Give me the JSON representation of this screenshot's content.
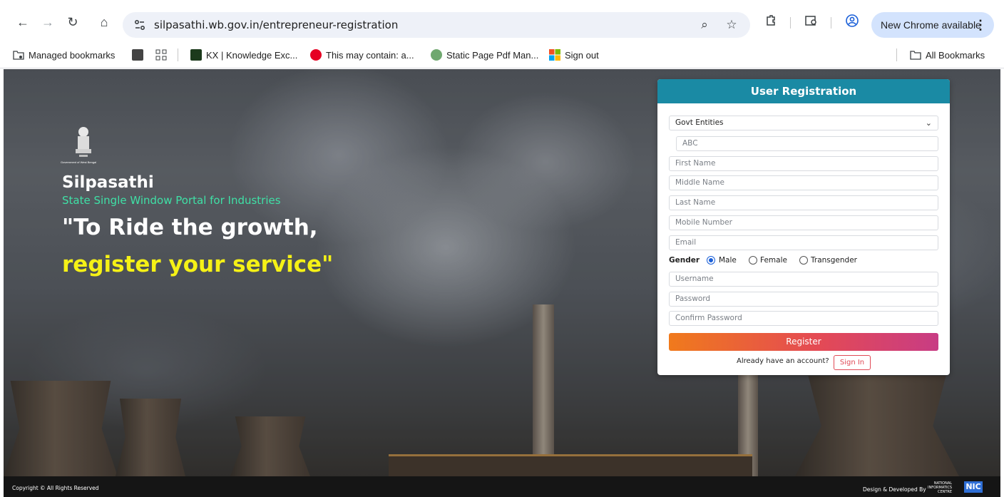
{
  "browser": {
    "url": "silpasathi.wb.gov.in/entrepreneur-registration",
    "update_label": "New Chrome available",
    "bookmarks": [
      {
        "label": "Managed bookmarks"
      },
      {
        "label": "KX | Knowledge Exc..."
      },
      {
        "label": "This may contain: a..."
      },
      {
        "label": "Static Page Pdf Man..."
      },
      {
        "label": "Sign out"
      }
    ],
    "all_bookmarks": "All Bookmarks"
  },
  "hero": {
    "emblem_caption": "Government of West Bengal",
    "brand": "Silpasathi",
    "tagline": "State Single Window Portal for Industries",
    "quote_line1": "\"To Ride the growth,",
    "quote_line2": "register your service\""
  },
  "form": {
    "title": "User Registration",
    "entity_select": "Govt Entities",
    "entity_name_placeholder": "ABC",
    "first_name": "First Name",
    "middle_name": "Middle Name",
    "last_name": "Last Name",
    "mobile": "Mobile Number",
    "email": "Email",
    "gender_label": "Gender",
    "gender_options": [
      "Male",
      "Female",
      "Transgender"
    ],
    "username": "Username",
    "password": "Password",
    "confirm_password": "Confirm Password",
    "register_label": "Register",
    "have_account": "Already have an account?",
    "signin_label": "Sign In"
  },
  "footer": {
    "copyright": "Copyright © All Rights Reserved",
    "developed_by": "Design & Developed By",
    "nic_line1": "NATIONAL",
    "nic_line2": "INFORMATICS",
    "nic_line3": "CENTRE",
    "nic_logo": "NIC"
  },
  "colors": {
    "card_header": "#1a8aa4",
    "tagline": "#3fe0a6",
    "quote_highlight": "#f5f116",
    "register_gradient_start": "#f07a1c",
    "register_gradient_end": "#c83c84",
    "signin": "#e04a56"
  }
}
